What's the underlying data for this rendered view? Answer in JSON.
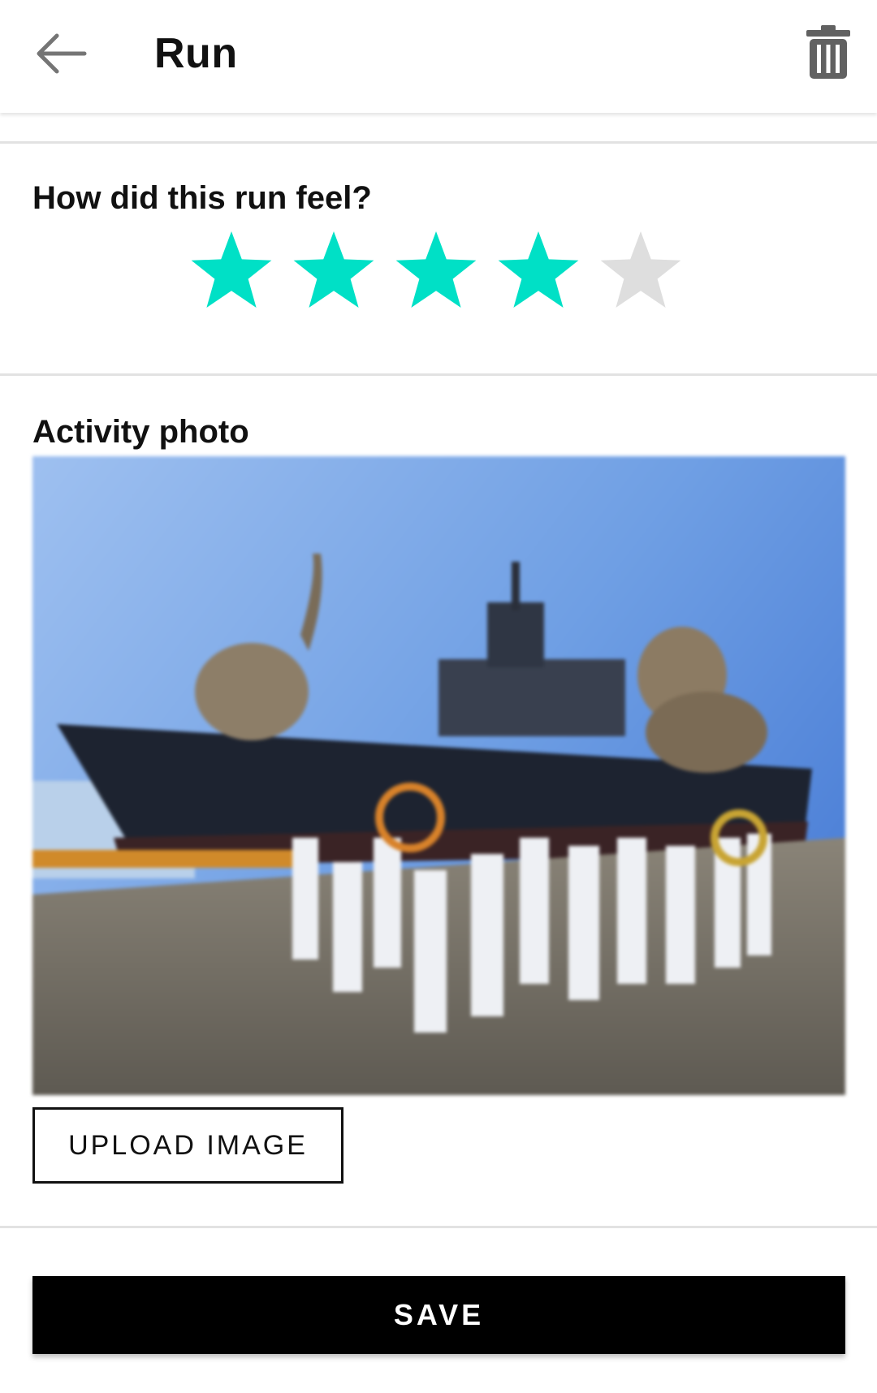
{
  "header": {
    "title": "Run",
    "back_icon": "arrow-left-icon",
    "delete_icon": "trash-icon"
  },
  "rating": {
    "question": "How did this run feel?",
    "value": 4,
    "max": 5,
    "active_color": "#00E0C6",
    "inactive_color": "#DEDEDE"
  },
  "photo": {
    "label": "Activity photo",
    "upload_label": "UPLOAD IMAGE"
  },
  "actions": {
    "save_label": "SAVE"
  }
}
